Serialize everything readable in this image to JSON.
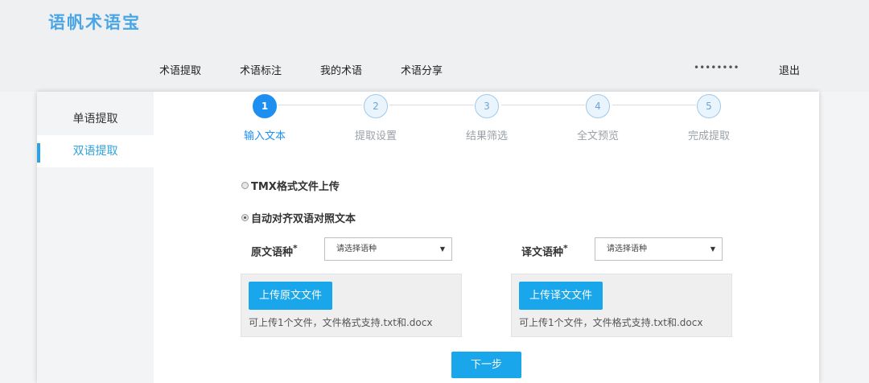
{
  "app": {
    "title": "语帆术语宝"
  },
  "nav": {
    "items": [
      "术语提取",
      "术语标注",
      "我的术语",
      "术语分享"
    ],
    "user": "••••••••",
    "logout": "退出"
  },
  "sidebar": {
    "items": [
      {
        "label": "单语提取",
        "active": false
      },
      {
        "label": "双语提取",
        "active": true
      }
    ]
  },
  "steps": [
    {
      "number": "1",
      "label": "输入文本",
      "active": true
    },
    {
      "number": "2",
      "label": "提取设置",
      "active": false
    },
    {
      "number": "3",
      "label": "结果筛选",
      "active": false
    },
    {
      "number": "4",
      "label": "全文预览",
      "active": false
    },
    {
      "number": "5",
      "label": "完成提取",
      "active": false
    }
  ],
  "options": {
    "tmx": {
      "label": "TMX格式文件上传",
      "checked": false
    },
    "align": {
      "label": "自动对齐双语对照文本",
      "checked": true
    }
  },
  "source": {
    "label": "原文语种",
    "required_mark": "*",
    "select_value": "请选择语种",
    "upload_label": "上传原文文件",
    "hint": "可上传1个文件，文件格式支持.txt和.docx"
  },
  "target": {
    "label": "译文语种",
    "required_mark": "*",
    "select_value": "请选择语种",
    "upload_label": "上传译文文件",
    "hint": "可上传1个文件，文件格式支持.txt和.docx"
  },
  "next_label": "下一步",
  "colors": {
    "accent": "#1d8ff0",
    "button": "#1aa6ea",
    "logo": "#4aa6e6"
  }
}
